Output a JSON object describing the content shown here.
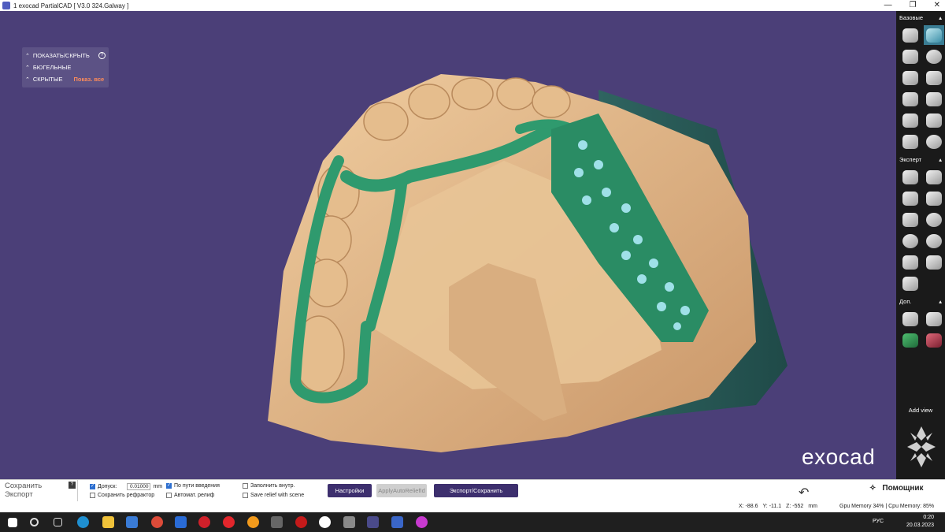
{
  "window": {
    "title": "1 exocad PartialCAD [ V3.0 324.Galway ]",
    "min": "—",
    "restore": "❐",
    "close": "✕"
  },
  "menu": {
    "show_hide": "ПОКАЗАТЬ/СКРЫТЬ",
    "help": "?",
    "clasp": "БЮГЕЛЬНЫЕ",
    "hidden": "СКРЫТЫЕ",
    "show_all": "Показ. все"
  },
  "brand": "exocad",
  "sidebar": {
    "basic": "Базовые",
    "expert": "Эксперт",
    "extra": "Доп.",
    "add_view": "Add view"
  },
  "bottom": {
    "save": "Сохранить",
    "export": "Экспорт",
    "qmark": "?",
    "tolerance_label": "Допуск:",
    "tolerance_value": "0.01000",
    "tolerance_unit": "mm",
    "save_refractor": "Сохранить рефрактор",
    "insertion_path": "По пути введения",
    "auto_relief": "Автомат. релиф",
    "fill_inside": "Заполнить внутр.",
    "save_relief_scene": "Save relief with scene",
    "settings_btn": "Настройки",
    "apply_relief_btn": "ApplyAutoReliefId",
    "export_save_btn": "Экспорт/Сохранить",
    "helper": "Помощник"
  },
  "status": {
    "x": "X: -88.6",
    "y": "Y: -11.1",
    "z": "Z: -552",
    "unit": "mm",
    "memory": "Gpu Memory 34% | Cpu Memory: 85%"
  },
  "taskbar": {
    "lang": "РУС",
    "time": "0:20",
    "date": "20.03.2023"
  },
  "colors": {
    "background": "#4b3f78",
    "model": "#e2b88a",
    "framework": "#2f9a6e",
    "accent": "#3d2f6e"
  }
}
